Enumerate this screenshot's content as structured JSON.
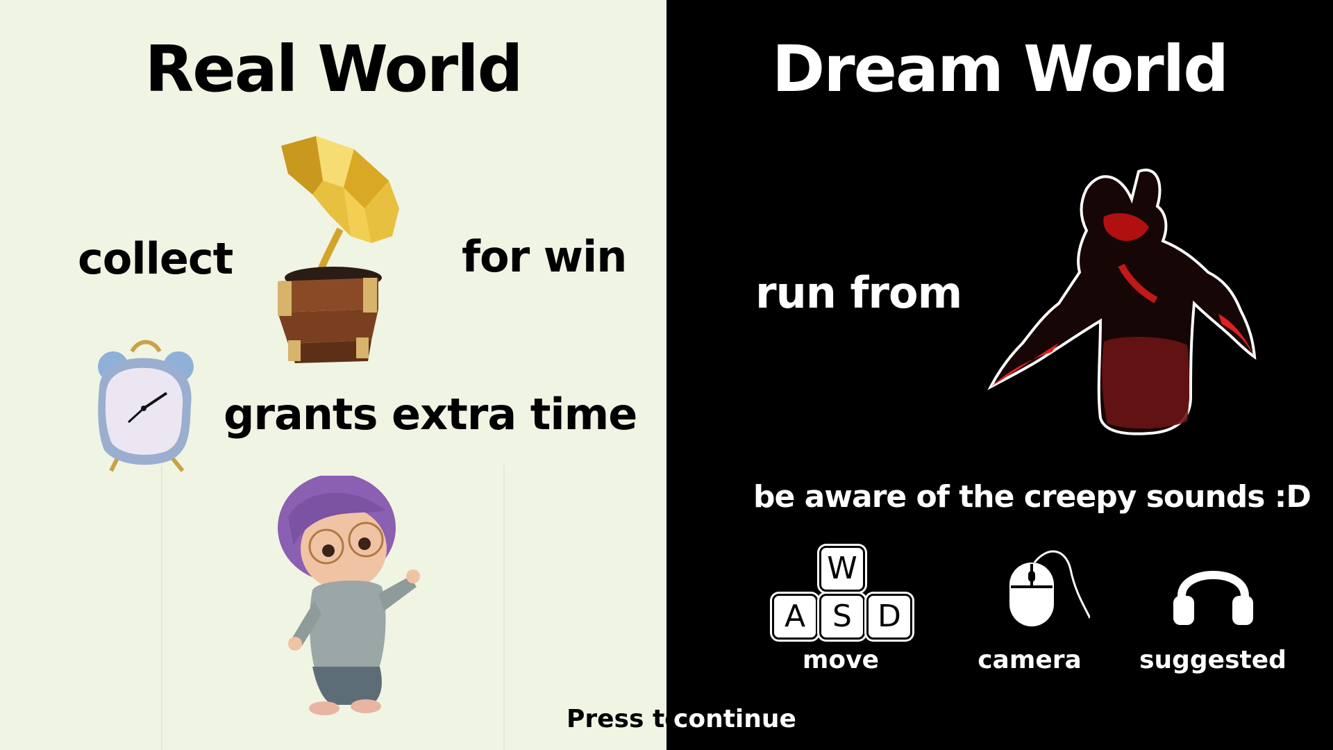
{
  "real_world": {
    "title": "Real World",
    "collect_text": "collect",
    "for_win_text": "for win",
    "clock_text": "grants extra time",
    "icons": {
      "collectible": "gramophone-icon",
      "bonus": "alarm-clock-icon",
      "player": "girl-character-icon"
    },
    "colors": {
      "background": "#f0f4e3",
      "text": "#000000",
      "gold": "#e8c040",
      "wood": "#8b4a26"
    }
  },
  "dream_world": {
    "title": "Dream World",
    "run_text": "run from",
    "warning_text": "be aware of the creepy sounds :D",
    "icons": {
      "enemy": "shadow-creature-icon"
    },
    "colors": {
      "background": "#000000",
      "text": "#ffffff",
      "enemy_accent": "#d01818"
    },
    "controls": [
      {
        "icon": "wasd-keys-icon",
        "keys": [
          "W",
          "A",
          "S",
          "D"
        ],
        "label": "move"
      },
      {
        "icon": "mouse-icon",
        "label": "camera"
      },
      {
        "icon": "headphones-icon",
        "label": "suggested"
      }
    ]
  },
  "footer": {
    "press_text": "Press to",
    "continue_text": "continue"
  }
}
